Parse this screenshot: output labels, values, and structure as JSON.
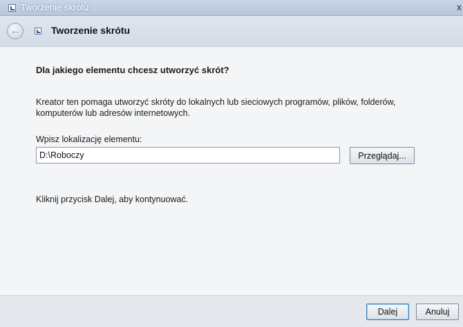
{
  "window": {
    "title": "Tworzenie skrótu",
    "close_glyph": "x"
  },
  "nav": {
    "back_glyph": "←",
    "title": "Tworzenie skrótu"
  },
  "content": {
    "heading": "Dla jakiego elementu chcesz utworzyć skrót?",
    "description": "Kreator ten pomaga utworzyć skróty do lokalnych lub sieciowych programów, plików, folderów, komputerów lub adresów internetowych.",
    "location_label": "Wpisz lokalizację elementu:",
    "location_value": "D:\\Roboczy",
    "browse_label": "Przeglądaj...",
    "hint": "Kliknij przycisk Dalej, aby kontynuować."
  },
  "footer": {
    "next_label": "Dalej",
    "cancel_label": "Anuluj"
  },
  "icons": {
    "window_icon": "shortcut-icon",
    "back": "back-arrow-icon"
  }
}
